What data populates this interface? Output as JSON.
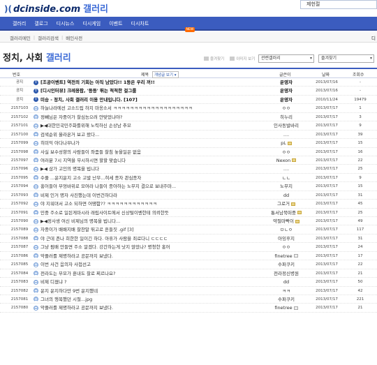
{
  "header": {
    "logo_mark": ")(",
    "logo_text": "dcinside.com",
    "logo_sub": "갤러리",
    "search_value": "제헌절"
  },
  "nav": {
    "items": [
      "갤러리",
      "갤로그",
      "디시뉴스",
      "디시게임",
      "이벤트",
      "디시차트"
    ],
    "new_badge": "NEW"
  },
  "subnav": {
    "items": [
      "갤러리메인",
      "갤러리검색",
      "배인사전"
    ],
    "right": "디"
  },
  "gallery": {
    "title_main": "정치, 사회 ",
    "title_accent": "갤러리"
  },
  "tools": {
    "subscribe": "즐겨찾기",
    "image_list": "이미지 보기",
    "related_select": "관련갤러리",
    "favorites_select": "즐겨찾기"
  },
  "table": {
    "headers": {
      "num": "번호",
      "subject": "제목",
      "sort": "개념글 보기",
      "writer": "글쓴이",
      "date": "날짜",
      "views": "조회수"
    },
    "rows": [
      {
        "num": "공지",
        "type": "notice",
        "subject": "[조공이벤트] 역전의 기회는 아직 남았다!! 1등은 우리 꺼!!",
        "writer": "운영자",
        "date": "2013/07/16",
        "views": "-",
        "wicon": ""
      },
      {
        "num": "공지",
        "type": "notice",
        "subject": "[디시인터뷰] 크레용팝, '등등' 뛰는 적적한 걸그룹",
        "writer": "운영자",
        "date": "2013/07/16",
        "views": "-",
        "wicon": ""
      },
      {
        "num": "공지",
        "type": "notice",
        "subject": "미승 - 정치, 사회 갤러리 이용 안내입니다. [107]",
        "writer": "운영자",
        "date": "2010/11/24",
        "views": "19479",
        "wicon": ""
      },
      {
        "num": "2157103",
        "type": "post",
        "subject": "하늘나라에선 고소드립 하지 마옹소서 ㅋㅋㅋㅋㅋㅋㅋㅋㅋㅋㅋㅋㅋㅋㅋㅋㅋㅋㅋ",
        "writer": "ㅇㅇ",
        "date": "2013/07/17",
        "views": "1",
        "wicon": ""
      },
      {
        "num": "2157102",
        "type": "post",
        "subject": "정빼님은 자중이가 찰심능으려 안맞었냐야?",
        "writer": "히누리",
        "date": "2013/07/17",
        "views": "3",
        "wicon": ""
      },
      {
        "num": "2157101",
        "type": "post",
        "subject": "▶◀대한민국민주화를위해 노력하신 손상남 추모",
        "writer": "인사동발바리",
        "date": "2013/07/17",
        "views": "9",
        "wicon": ""
      },
      {
        "num": "2157100",
        "type": "post",
        "subject": "검색순위 올라온거 보고 왔다...",
        "writer": "....",
        "date": "2013/07/17",
        "views": "39",
        "wicon": ""
      },
      {
        "num": "2157099",
        "type": "post",
        "subject": "히미익 아다나부나가",
        "writer": "pL",
        "date": "2013/07/17",
        "views": "15",
        "wicon": "y"
      },
      {
        "num": "2157098",
        "type": "post",
        "subject": "사실 보수성향의 사람들이 좌좀들 찰침 놓을일은 없음",
        "writer": "ㅇㅇ",
        "date": "2013/07/17",
        "views": "16",
        "wicon": ""
      },
      {
        "num": "2157097",
        "type": "post",
        "subject": "여러분 7시 지역을 무시하시면 할할 맞습니다",
        "writer": "Nexon",
        "date": "2013/07/17",
        "views": "22",
        "wicon": "y"
      },
      {
        "num": "2157096",
        "type": "post",
        "subject": "▶◀ 삼가 고인의 명복을 빕니다",
        "writer": "....",
        "date": "2013/07/17",
        "views": "25",
        "wicon": ""
      },
      {
        "num": "2157095",
        "type": "post",
        "subject": "수풀 ...운지운지 고소 고발 난무...혀세 종자 관심종자",
        "writer": "ㄴㄴ",
        "date": "2013/07/17",
        "views": "9",
        "wicon": ""
      },
      {
        "num": "2157094",
        "type": "post",
        "subject": "홍어들아 부엉바위로 모여라 나들이 종아하는 노무지 결으로 보내주마...",
        "writer": "노무지",
        "date": "2013/07/17",
        "views": "15",
        "wicon": ""
      },
      {
        "num": "2157093",
        "type": "post",
        "subject": "비제 인거 명자 사진했는데 이번건하다라",
        "writer": "dd",
        "date": "2013/07/17",
        "views": "31",
        "wicon": ""
      },
      {
        "num": "2157092",
        "type": "post",
        "subject": "야 지워뎌서 고소 되하면 어땡함?? ㅋㅋㅋㅋㅋㅋㅋㅋㅋㅋㅋㅋ",
        "writer": "그로거",
        "date": "2013/07/17",
        "views": "45",
        "wicon": "y"
      },
      {
        "num": "2157091",
        "type": "post",
        "subject": "민중 주소로 일된게마시라 래립사이트에서 신상털이벤한테 의뢰한듯",
        "writer": "통서남북떠중",
        "date": "2013/07/17",
        "views": "25",
        "wicon": "y"
      },
      {
        "num": "2157090",
        "type": "post",
        "subject": "▶◀정사생 여신 비제님의 명복을 빕니다...",
        "writer": "약절마빡이",
        "date": "2013/07/17",
        "views": "49",
        "wicon": "y"
      },
      {
        "num": "2157089",
        "type": "post",
        "subject": "자중이가 배배지배 찰찬말 뛰고로 흔들짓 .gif [3]",
        "writer": "ㅁㄴㅇ",
        "date": "2013/07/17",
        "views": "117",
        "wicon": ""
      },
      {
        "num": "2157088",
        "type": "post",
        "subject": "야 근데 존나 희한한 일이긴 하다. 아휴가 사람을 죄로다니 ㄷㄷㄷㄷ",
        "writer": "아잉후지",
        "date": "2013/07/17",
        "views": "31",
        "wicon": ""
      },
      {
        "num": "2157087",
        "type": "post",
        "subject": "그냥 펌배 안들면 주소 알겠다. 강간하는게 낫지 않았나? 명청한 홍어",
        "writer": "ㅇㅇ",
        "date": "2013/07/17",
        "views": "24",
        "wicon": ""
      },
      {
        "num": "2157086",
        "type": "post",
        "subject": "악플러를 제명하라고 공문까지 보냈다.",
        "writer": "finetree",
        "date": "2013/07/17",
        "views": "17",
        "wicon": "g"
      },
      {
        "num": "2157085",
        "type": "post",
        "subject": "이번 사건 음의자 사첩선고",
        "writer": "수퍼쿠키",
        "date": "2013/07/17",
        "views": "22",
        "wicon": ""
      },
      {
        "num": "2157084",
        "type": "post",
        "subject": "전라도는 부모가 훈내도 찰로 찌르나요?",
        "writer": "전라정신병원",
        "date": "2013/07/17",
        "views": "21",
        "wicon": ""
      },
      {
        "num": "2157083",
        "type": "post",
        "subject": "비제 디졌냐 ?",
        "writer": "dd",
        "date": "2013/07/17",
        "views": "50",
        "wicon": ""
      },
      {
        "num": "2157082",
        "type": "post",
        "subject": "운지 운지하다만 9번 운지했네",
        "writer": "ㅋㅋ",
        "date": "2013/07/17",
        "views": "42",
        "wicon": ""
      },
      {
        "num": "2157081",
        "type": "post",
        "subject": "그녀의 행복했던 시절...jpg",
        "writer": "수퍼쿠키",
        "date": "2013/07/17",
        "views": "221",
        "wicon": ""
      },
      {
        "num": "2157080",
        "type": "post",
        "subject": "악플러를 제명하라고 공문까지 보냈다.",
        "writer": "finetree",
        "date": "2013/07/17",
        "views": "21",
        "wicon": "g"
      }
    ]
  }
}
